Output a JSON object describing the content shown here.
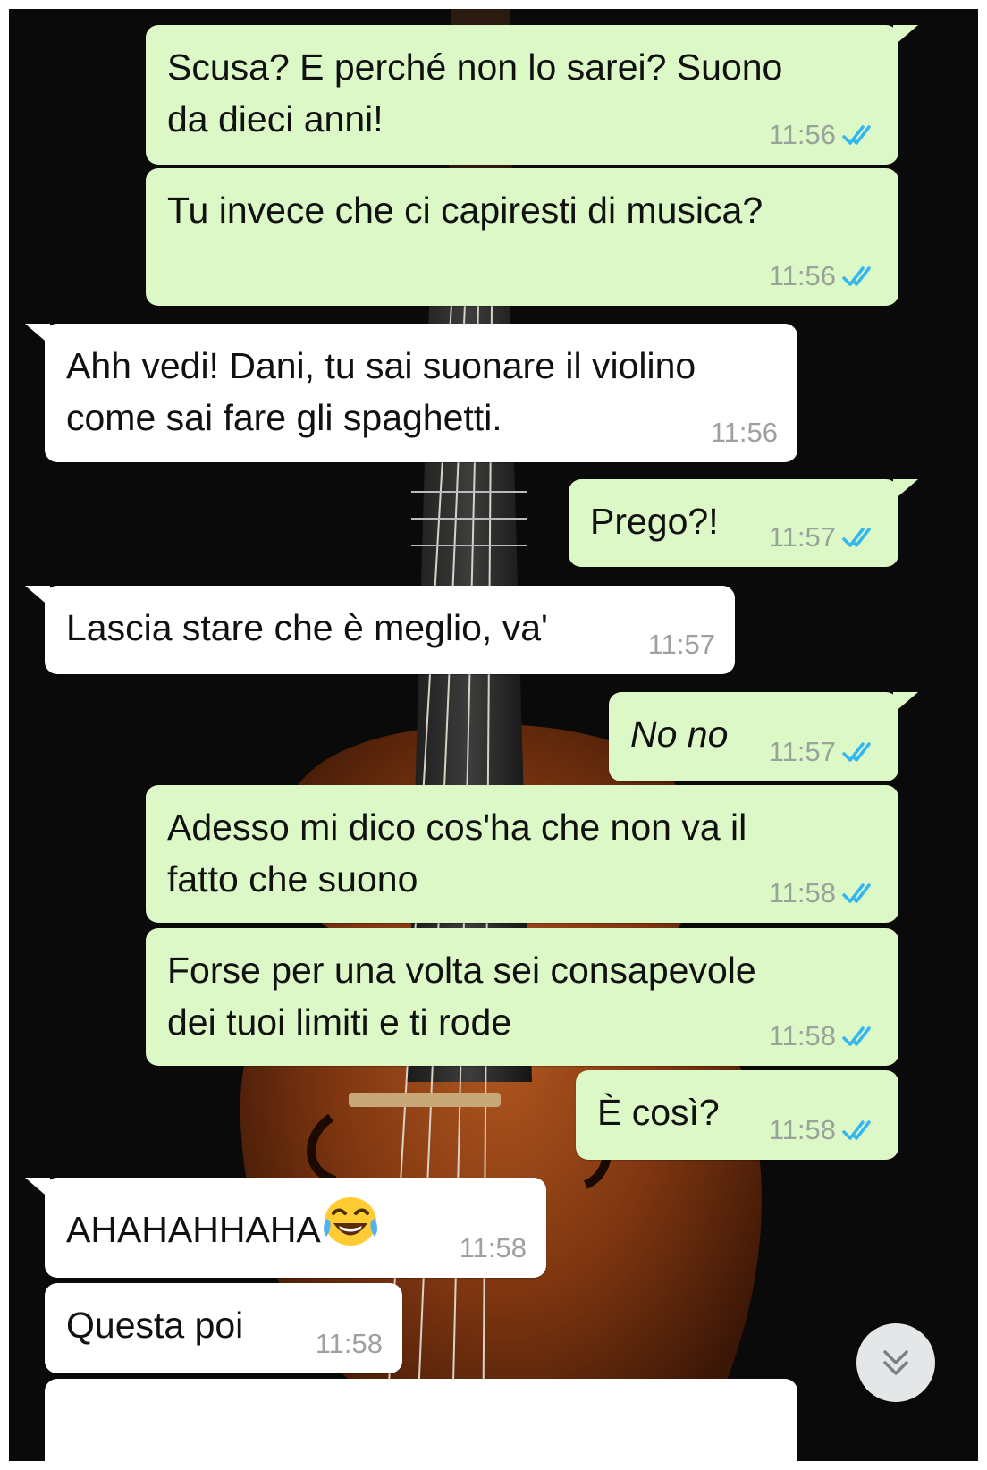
{
  "colors": {
    "outgoing_bubble": "#dcf8c6",
    "incoming_bubble": "#ffffff",
    "read_ticks": "#34b7f1",
    "background": "#0a0a0a"
  },
  "wallpaper": {
    "icon": "violin-photo"
  },
  "messages": [
    {
      "direction": "outgoing",
      "text": "Scusa? E perché non lo sarei? Suono\nda dieci anni!",
      "time": "11:56",
      "status": "read"
    },
    {
      "direction": "outgoing",
      "text": "Tu invece che ci capiresti di musica?",
      "time": "11:56",
      "status": "read"
    },
    {
      "direction": "incoming",
      "text": "Ahh vedi! Dani, tu sai suonare il violino\ncome sai fare gli spaghetti.",
      "time": "11:56"
    },
    {
      "direction": "outgoing",
      "text": "Prego?!",
      "time": "11:57",
      "status": "read"
    },
    {
      "direction": "incoming",
      "text": "Lascia stare che è meglio, va'",
      "time": "11:57"
    },
    {
      "direction": "outgoing",
      "text": "No no",
      "time": "11:57",
      "status": "read"
    },
    {
      "direction": "outgoing",
      "text": "Adesso mi dico cos'ha che non va il\nfatto che suono",
      "time": "11:58",
      "status": "read"
    },
    {
      "direction": "outgoing",
      "text": "Forse per una volta sei consapevole\ndei tuoi limiti e ti rode",
      "time": "11:58",
      "status": "read"
    },
    {
      "direction": "outgoing",
      "text": "È così?",
      "time": "11:58",
      "status": "read"
    },
    {
      "direction": "incoming",
      "text": "AHAHAHHAHA",
      "emoji": "face-with-tears-of-joy-icon",
      "time": "11:58"
    },
    {
      "direction": "incoming",
      "text": "Questa poi",
      "time": "11:58"
    }
  ],
  "scroll_button": {
    "icon": "double-chevron-down-icon"
  }
}
